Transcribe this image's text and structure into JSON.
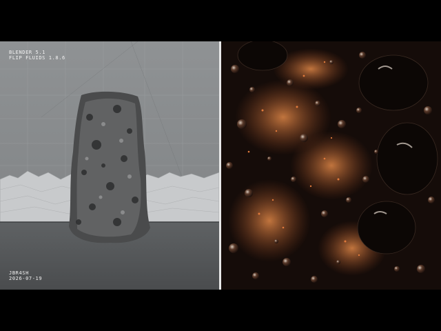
{
  "viewport": {
    "app_label": "BLENDER 5.1",
    "addon_label": "FLIP FLUIDS 1.8.6",
    "author_label": "JBR4SH",
    "date_label": "2026-07-19"
  },
  "colors": {
    "letterbox": "#000000",
    "viewport_bg": "#8a8d8f",
    "divider": "#e8e8e8",
    "render_bg": "#120a08",
    "foam_orange": "#d2753a",
    "bubble_highlight": "#c9b9aa"
  }
}
